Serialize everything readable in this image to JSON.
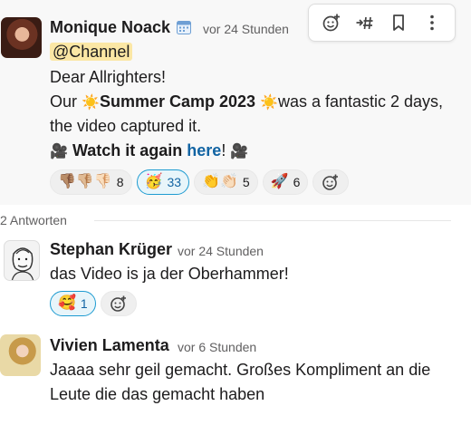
{
  "parent": {
    "author": "Monique Noack",
    "status_icon": "calendar-icon",
    "time": "vor 24 Stunden",
    "mention": "@Channel",
    "line1": "Dear Allrighters!",
    "line2_prefix": "Our ",
    "line2_bold": "Summer Camp 2023",
    "line2_suffix": "was a fantastic 2 days,",
    "line3": "the video captured it.",
    "line4_bold": "Watch it again ",
    "line4_link": "here",
    "line4_after": "!",
    "reactions": [
      {
        "emoji": "👎🏽👎🏼👎🏻",
        "count": "8",
        "active": false
      },
      {
        "emoji": "🥳",
        "count": "33",
        "active": true
      },
      {
        "emoji": "👏👏🏻",
        "count": "5",
        "active": false
      },
      {
        "emoji": "🚀",
        "count": "6",
        "active": false
      }
    ]
  },
  "toolbar": {
    "items": [
      "add-reaction-icon",
      "reply-in-channel-icon",
      "bookmark-icon",
      "more-actions-icon"
    ]
  },
  "replies": {
    "label": "2 Antworten",
    "items": [
      {
        "author": "Stephan Krüger",
        "time": "vor 24 Stunden",
        "text": "das Video is ja der Oberhammer!",
        "reactions": [
          {
            "emoji": "🥰",
            "count": "1",
            "active": true
          }
        ]
      },
      {
        "author": "Vivien Lamenta",
        "time": "vor 6 Stunden",
        "line1": "Jaaaa sehr geil gemacht. Großes Kompliment an die",
        "line2": "Leute die das gemacht haben"
      }
    ]
  },
  "colors": {
    "link": "#1264a3",
    "mention_bg": "#fbe7a5",
    "active_reaction_border": "#1d9bd1",
    "active_reaction_bg": "#e8f5fa"
  }
}
